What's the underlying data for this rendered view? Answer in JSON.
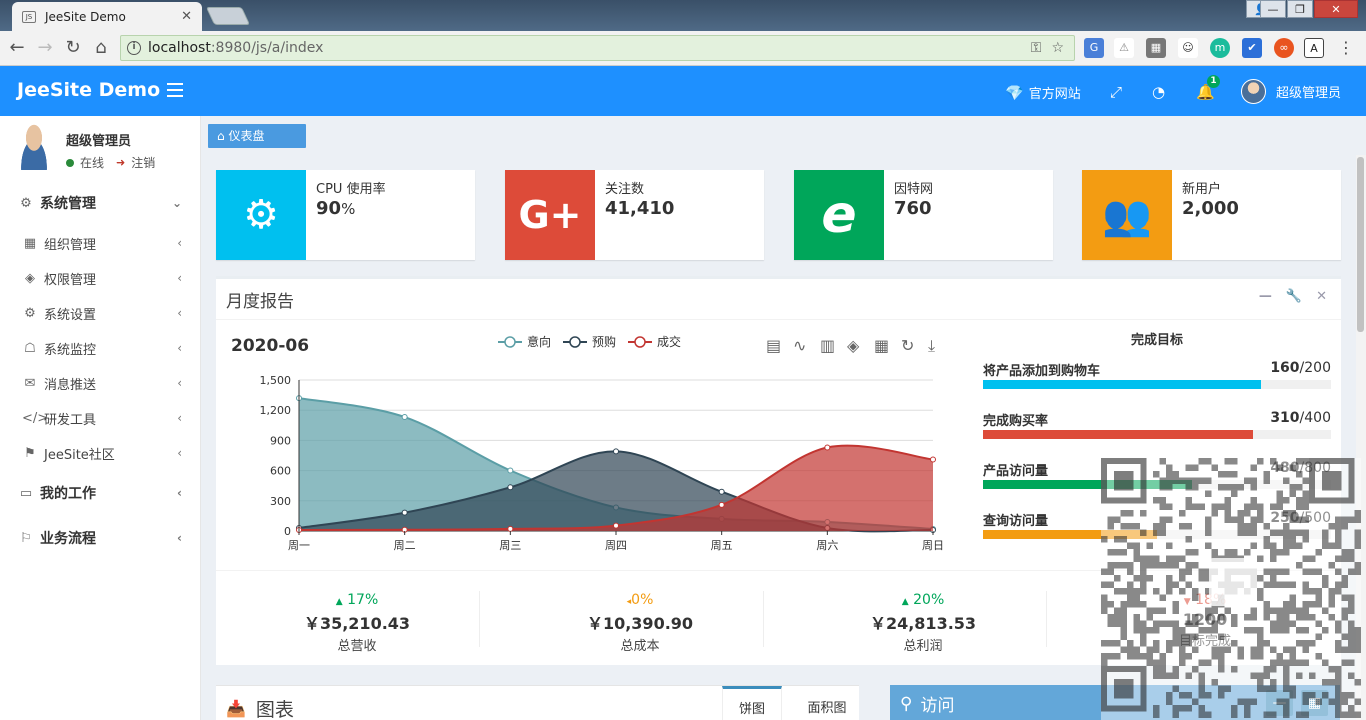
{
  "browser": {
    "tab_title": "JeeSite Demo",
    "tab_icon_text": "JS",
    "url_host": "localhost",
    "url_rest": ":8980/js/a/index"
  },
  "header": {
    "logo": "JeeSite Demo",
    "official_site": "官方网站",
    "notification_count": "1",
    "user_name": "超级管理员"
  },
  "sidebar": {
    "user_name": "超级管理员",
    "status": "在线",
    "logout": "注销",
    "menu": [
      {
        "label": "系统管理",
        "icon": "gear-icon",
        "level": "top"
      },
      {
        "label": "组织管理",
        "icon": "grid-icon",
        "level": "sub"
      },
      {
        "label": "权限管理",
        "icon": "layers-icon",
        "level": "sub"
      },
      {
        "label": "系统设置",
        "icon": "gear-icon",
        "level": "sub"
      },
      {
        "label": "系统监控",
        "icon": "ghost-icon",
        "level": "sub"
      },
      {
        "label": "消息推送",
        "icon": "mail-icon",
        "level": "sub"
      },
      {
        "label": "研发工具",
        "icon": "code-icon",
        "level": "sub"
      },
      {
        "label": "JeeSite社区",
        "icon": "signpost-icon",
        "level": "sub"
      },
      {
        "label": "我的工作",
        "icon": "desktop-icon",
        "level": "top"
      },
      {
        "label": "业务流程",
        "icon": "flag-icon",
        "level": "top"
      }
    ]
  },
  "breadcrumb": "仪表盘",
  "info_boxes": [
    {
      "label": "CPU 使用率",
      "value": "90",
      "unit": "%",
      "color": "#00c0ef",
      "icon": "gear-icon"
    },
    {
      "label": "关注数",
      "value": "41,410",
      "unit": "",
      "color": "#dd4b39",
      "icon": "google-plus-icon"
    },
    {
      "label": "因特网",
      "value": "760",
      "unit": "",
      "color": "#00a65a",
      "icon": "ie-icon"
    },
    {
      "label": "新用户",
      "value": "2,000",
      "unit": "",
      "color": "#f39c12",
      "icon": "users-icon"
    }
  ],
  "report": {
    "title": "月度报告",
    "period": "2020-06",
    "goals_title": "完成目标",
    "goals": [
      {
        "label": "将产品添加到购物车",
        "current": "160",
        "total": "/200",
        "ratio": 0.8,
        "color": "#00c0ef"
      },
      {
        "label": "完成购买率",
        "current": "310",
        "total": "/400",
        "ratio": 0.775,
        "color": "#dd4b39"
      },
      {
        "label": "产品访问量",
        "current": "480",
        "total": "/800",
        "ratio": 0.6,
        "color": "#00a65a"
      },
      {
        "label": "查询访问量",
        "current": "250",
        "total": "/500",
        "ratio": 0.5,
        "color": "#f39c12"
      }
    ],
    "stats": [
      {
        "pct": "17%",
        "dir": "up",
        "color": "#00a65a",
        "amount": "￥35,210.43",
        "label": "总营收"
      },
      {
        "pct": "0%",
        "dir": "left",
        "color": "#f39c12",
        "amount": "￥10,390.90",
        "label": "总成本"
      },
      {
        "pct": "20%",
        "dir": "up",
        "color": "#00a65a",
        "amount": "￥24,813.53",
        "label": "总利润"
      },
      {
        "pct": "18%",
        "dir": "down",
        "color": "#dd4b39",
        "amount": "1200",
        "label": "目标完成"
      }
    ]
  },
  "chart_data": {
    "type": "area",
    "categories": [
      "周一",
      "周二",
      "周三",
      "周四",
      "周五",
      "周六",
      "周日"
    ],
    "series": [
      {
        "name": "意向",
        "values": [
          1320,
          1132,
          601,
          234,
          120,
          90,
          20
        ],
        "color": "#5b9ea6"
      },
      {
        "name": "预购",
        "values": [
          30,
          182,
          434,
          791,
          390,
          30,
          10
        ],
        "color": "#2f4554"
      },
      {
        "name": "成交",
        "values": [
          10,
          12,
          21,
          54,
          260,
          830,
          710
        ],
        "color": "#c23531"
      }
    ],
    "yticks": [
      "0",
      "300",
      "600",
      "900",
      "1,200",
      "1,500"
    ],
    "ylim": [
      0,
      1500
    ],
    "legend": "top-center"
  },
  "charts_panel": {
    "title": "图表",
    "tab_pie": "饼图",
    "tab_area": "面积图"
  },
  "visits_panel": {
    "title": "访问"
  }
}
